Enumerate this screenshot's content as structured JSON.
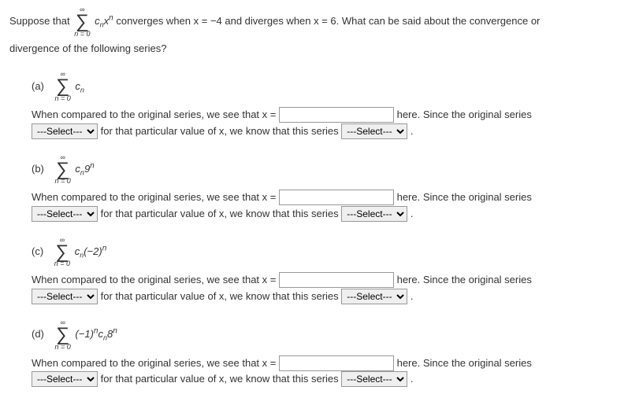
{
  "intro": {
    "pre": "Suppose that  ",
    "sum_top": "∞",
    "sum_bottom": "n = 0",
    "sum_term_html": "cₙxⁿ",
    "post": " converges when x = −4 and diverges when x = 6. What can be said about the convergence or"
  },
  "intro2": "divergence of the following series?",
  "parts": {
    "a": {
      "label": "(a)",
      "sum_top": "∞",
      "sum_bottom": "n = 0",
      "term": "cₙ",
      "line1_pre": "When compared to the original series, we see that  x = ",
      "line1_post": "  here. Since the original series",
      "line2_mid": " for that particular value of x, we know that this series ",
      "line2_end": " .",
      "select_default": "---Select---"
    },
    "b": {
      "label": "(b)",
      "sum_top": "∞",
      "sum_bottom": "n = 0",
      "term": "cₙ9ⁿ",
      "line1_pre": "When compared to the original series, we see that  x = ",
      "line1_post": "  here. Since the original series",
      "line2_mid": " for that particular value of x, we know that this series ",
      "line2_end": " .",
      "select_default": "---Select---"
    },
    "c": {
      "label": "(c)",
      "sum_top": "∞",
      "sum_bottom": "n = 0",
      "term": "cₙ(−2)ⁿ",
      "line1_pre": "When compared to the original series, we see that  x = ",
      "line1_post": "  here. Since the original series",
      "line2_mid": " for that particular value of x, we know that this series ",
      "line2_end": " .",
      "select_default": "---Select---"
    },
    "d": {
      "label": "(d)",
      "sum_top": "∞",
      "sum_bottom": "n = 0",
      "term": "(−1)ⁿcₙ8ⁿ",
      "line1_pre": "When compared to the original series, we see that  x = ",
      "line1_post": "  here. Since the original series",
      "line2_mid": " for that particular value of x, we know that this series ",
      "line2_end": " .",
      "select_default": "---Select---"
    }
  }
}
